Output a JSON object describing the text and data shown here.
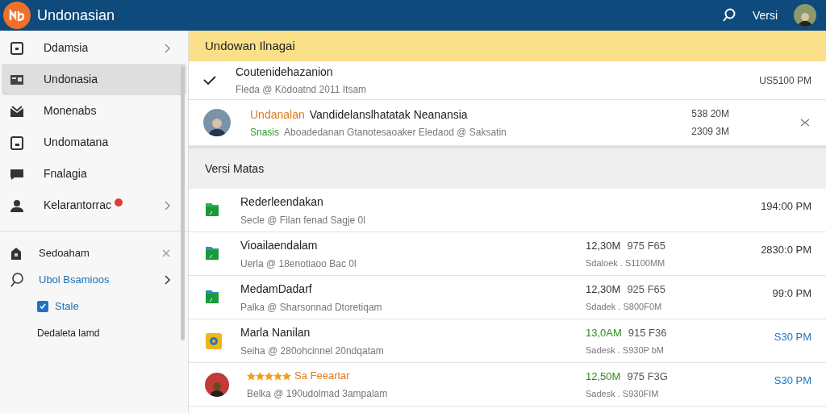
{
  "app": {
    "title": "Undonasian",
    "header_link": "Versi"
  },
  "sidebar": {
    "items": [
      {
        "label": "Ddamsia",
        "selected": false,
        "chevron": true,
        "badge": false
      },
      {
        "label": "Undonasia",
        "selected": true,
        "chevron": false,
        "badge": false
      },
      {
        "label": "Monenabs",
        "selected": false,
        "chevron": false,
        "badge": false
      },
      {
        "label": "Undomatana",
        "selected": false,
        "chevron": false,
        "badge": false
      },
      {
        "label": "Fnalagia",
        "selected": false,
        "chevron": false,
        "badge": false
      },
      {
        "label": "Kelarantorrac",
        "selected": false,
        "chevron": true,
        "badge": true
      }
    ],
    "secondary": [
      {
        "kind": "close",
        "label": "Sedoaham"
      },
      {
        "kind": "search",
        "label": "Ubol Bsamioos"
      },
      {
        "kind": "checkbox",
        "label": "Stale",
        "checked": true
      },
      {
        "kind": "text",
        "label": "Dedaleta lamd"
      }
    ]
  },
  "banner": "Undowan Ilnagai",
  "notifications": [
    {
      "kind": "check",
      "title": "Coutenidehazanion",
      "subtitle": "Fleda @ Ködoatnd 2011 Itsam",
      "times": [
        "US5100 PM"
      ]
    },
    {
      "kind": "avatar",
      "tag": "Undanalan",
      "title": "Vandidelanslhatatak Neanansia",
      "status": "Snasis",
      "subtitle": "Aboadedanan Gtanotesaoaker Eledaod @ Saksatin",
      "times": [
        "538 20M",
        "2309 3M"
      ]
    }
  ],
  "section_title": "Versi Matas",
  "rows": [
    {
      "kind": "file",
      "title": "Rederleendakan",
      "subtitle": "Secle @ Filan fenad Sagje 0l",
      "time": "194:00 PM",
      "highlighted": false
    },
    {
      "kind": "file",
      "title": "Vioailaendalam",
      "subtitle": "Uerla @ 18enotiaoo Bac 0l",
      "size": "12,30M",
      "code": "975 F65",
      "detail": "Sdaloek . S1100MM",
      "time": "2830:0 PM",
      "highlighted": false
    },
    {
      "kind": "file",
      "title": "MedamDadarf",
      "subtitle": "Palka @ Sharsonnad Dtoretiqam",
      "size": "12,30M",
      "code": "925 F65",
      "detail": "Sdadek . S800F0M",
      "time": "99:0 PM",
      "highlighted": false
    },
    {
      "kind": "app",
      "title": "Marla Nanilan",
      "subtitle": "Seiha @ 280ohcinnel 20ndqatam",
      "size": "13,0AM",
      "code": "915 F36",
      "detail": "Sadesk . S930P bM",
      "time": "S30 PM",
      "highlighted": true
    },
    {
      "kind": "avatar",
      "stars": 5,
      "title": "Sa Feeartar",
      "subtitle": "Belka @ 190udolmad 3ampalam",
      "size": "12,50M",
      "code": "975 F3G",
      "detail": "Sadesk . S930FIM",
      "time": "S30 PM",
      "highlighted": true
    }
  ]
}
